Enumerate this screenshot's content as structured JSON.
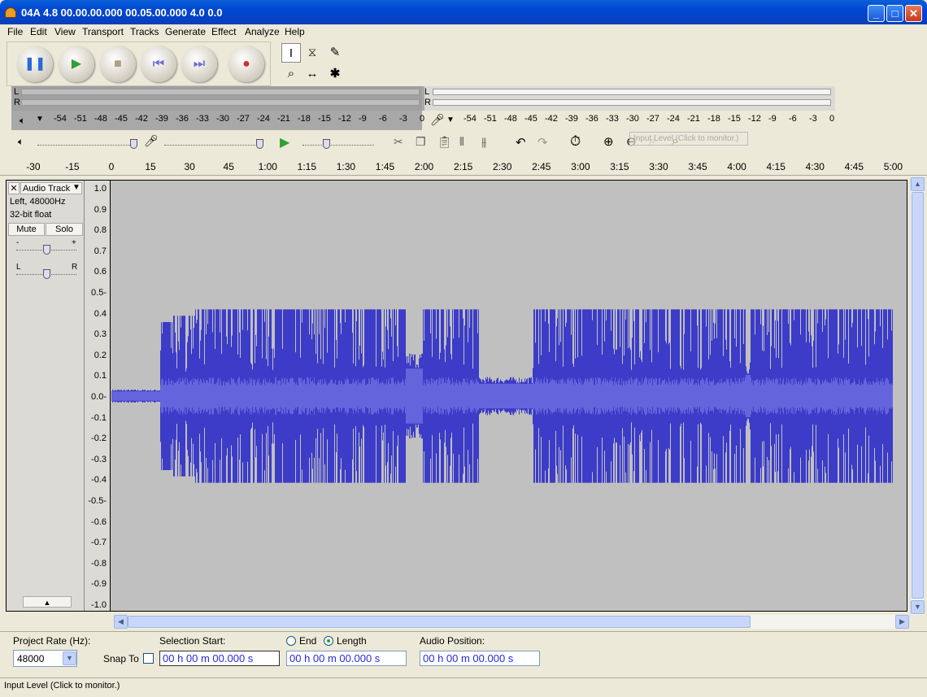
{
  "window": {
    "title": "04A  4.8  00.00.00.000  00.05.00.000  4.0  0.0"
  },
  "menu": [
    "File",
    "Edit",
    "View",
    "Transport",
    "Tracks",
    "Generate",
    "Effect",
    "Analyze",
    "Help"
  ],
  "meters": {
    "play_ticks": [
      "-54",
      "-51",
      "-48",
      "-45",
      "-42",
      "-39",
      "-36",
      "-33",
      "-30",
      "-27",
      "-24",
      "-21",
      "-18",
      "-15",
      "-12",
      "-9",
      "-6",
      "-3",
      "0"
    ],
    "rec_ticks": [
      "-54",
      "-51",
      "-48",
      "-45",
      "-42",
      "-39",
      "-36",
      "-33",
      "-30",
      "-27",
      "-24",
      "-21",
      "-18",
      "-15",
      "-12",
      "-9",
      "-6",
      "-3",
      "0"
    ],
    "channel_l": "L",
    "channel_r": "R",
    "tooltip": "Input Level (Click to monitor.)"
  },
  "ruler": [
    "-30",
    "-15",
    "0",
    "15",
    "30",
    "45",
    "1:00",
    "1:15",
    "1:30",
    "1:45",
    "2:00",
    "2:15",
    "2:30",
    "2:45",
    "3:00",
    "3:15",
    "3:30",
    "3:45",
    "4:00",
    "4:15",
    "4:30",
    "4:45",
    "5:00"
  ],
  "track": {
    "name": "Audio Track",
    "info1": "Left, 48000Hz",
    "info2": "32-bit float",
    "mute": "Mute",
    "solo": "Solo",
    "gain_minus": "-",
    "gain_plus": "+",
    "pan_left": "L",
    "pan_right": "R"
  },
  "vruler": [
    "1.0",
    "0.9",
    "0.8",
    "0.7",
    "0.6",
    "0.5-",
    "0.4",
    "0.3",
    "0.2",
    "0.1",
    "0.0-",
    "-0.1",
    "-0.2",
    "-0.3",
    "-0.4",
    "-0.5-",
    "-0.6",
    "-0.7",
    "-0.8",
    "-0.9",
    "-1.0"
  ],
  "selection": {
    "project_rate_label": "Project Rate (Hz):",
    "project_rate": "48000",
    "snap_to": "Snap To",
    "selection_start_label": "Selection Start:",
    "end_label": "End",
    "length_label": "Length",
    "audio_position_label": "Audio Position:",
    "start_value": "00 h 00 m 00.000 s",
    "length_value": "00 h 00 m 00.000 s",
    "position_value": "00 h 00 m 00.000 s"
  },
  "status": {
    "text": "Input Level (Click to monitor.)"
  },
  "colors": {
    "wave": "#3c3cc8",
    "wave_rms": "#6464dc",
    "track_bg": "#c0c0c0"
  }
}
